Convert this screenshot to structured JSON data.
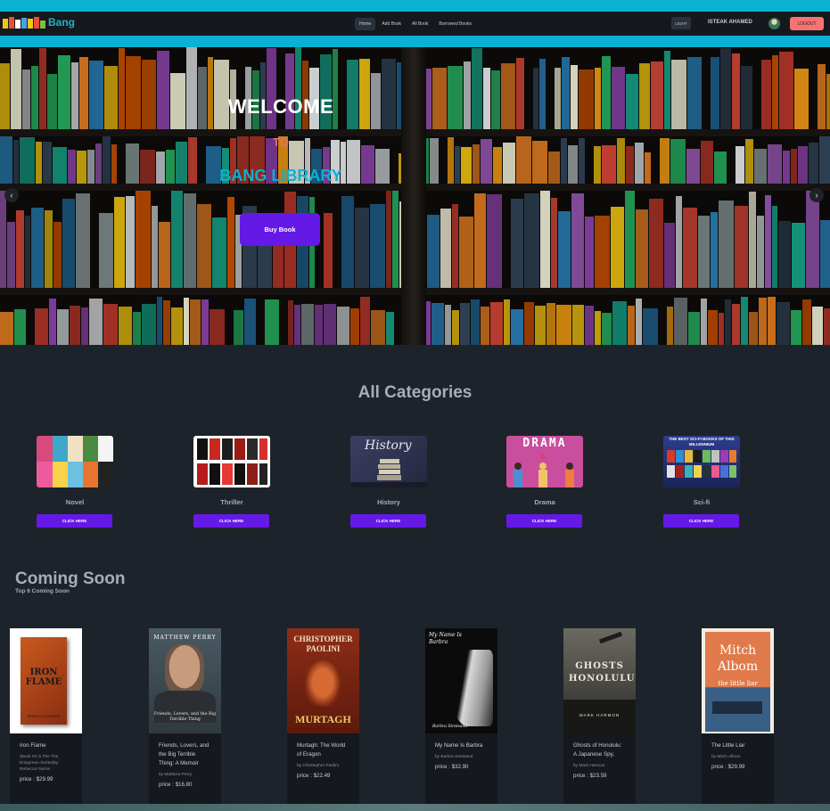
{
  "navbar": {
    "logo_text": "Bang",
    "links": [
      {
        "label": "Home",
        "active": true
      },
      {
        "label": "Add Book",
        "active": false
      },
      {
        "label": "All Book",
        "active": false
      },
      {
        "label": "Borrowed Books",
        "active": false
      }
    ],
    "theme_toggle": "LIGHT",
    "username": "ISTEAK AHAMED",
    "logout_label": "LOGOUT"
  },
  "hero": {
    "welcome": "WELCOME",
    "to": "TO",
    "library_name": "BANG LIBRARY",
    "button_label": "Buy Book",
    "prev_arrow": "‹",
    "next_arrow": "›"
  },
  "categories": {
    "title": "All Categories",
    "button_label": "CLICK HERE",
    "items": [
      {
        "name": "Novel"
      },
      {
        "name": "Thriller"
      },
      {
        "name": "History",
        "image_text": "History"
      },
      {
        "name": "Drama",
        "image_text": "DRAMA"
      },
      {
        "name": "Sci-fi",
        "image_text": "THE BEST SCI-FI BOOKS OF THIS MILLENNIUM"
      }
    ]
  },
  "coming_soon": {
    "title": "Coming Soon",
    "subtitle": "Top 6 Coming Soon",
    "books": [
      {
        "title": "Iron Flame",
        "author": "(Book #2 in The The Empyrean Series)by Rebecca Yarros",
        "price": "price : $29.99",
        "cover_text": "IRON FLAME",
        "cover_author": "REBECCA YARROS"
      },
      {
        "title": "Friends, Lovers, and the Big Terrible Thing: A Memoir",
        "author": "by Matthew Perry",
        "price": "price : $16.80",
        "cover_author": "MATTHEW PERRY",
        "cover_text": "Friends, Lovers, and the Big Terrible Thing"
      },
      {
        "title": "Murtagh: The World of Eragon",
        "author": "by Christopher Paolini",
        "price": "price : $22.49",
        "cover_author": "CHRISTOPHER PAOLINI",
        "cover_text": "MURTAGH"
      },
      {
        "title": "My Name Is Barbra",
        "author": "by Barbra Streisand",
        "price": "price : $32.90",
        "cover_text": "My Name Is Barbra",
        "cover_author": "Barbra Streisand"
      },
      {
        "title": "Ghosts of Honolulu: A Japanese Spy,",
        "author": "by Mark Harmon",
        "price": "price : $23.59",
        "cover_text": "GHOSTS HONOLULU",
        "cover_author": "MARK HARMON"
      },
      {
        "title": "The Little Liar",
        "author": "by Mitch Albom",
        "price": "price : $29.99",
        "cover_author": "Mitch Albom",
        "cover_text": "the little liar"
      }
    ]
  },
  "colors": {
    "accent_cyan": "#0ab1d3",
    "primary_purple": "#6419e6",
    "logout_red": "#f87272",
    "background": "#1d232a",
    "navbar": "#15191e"
  }
}
